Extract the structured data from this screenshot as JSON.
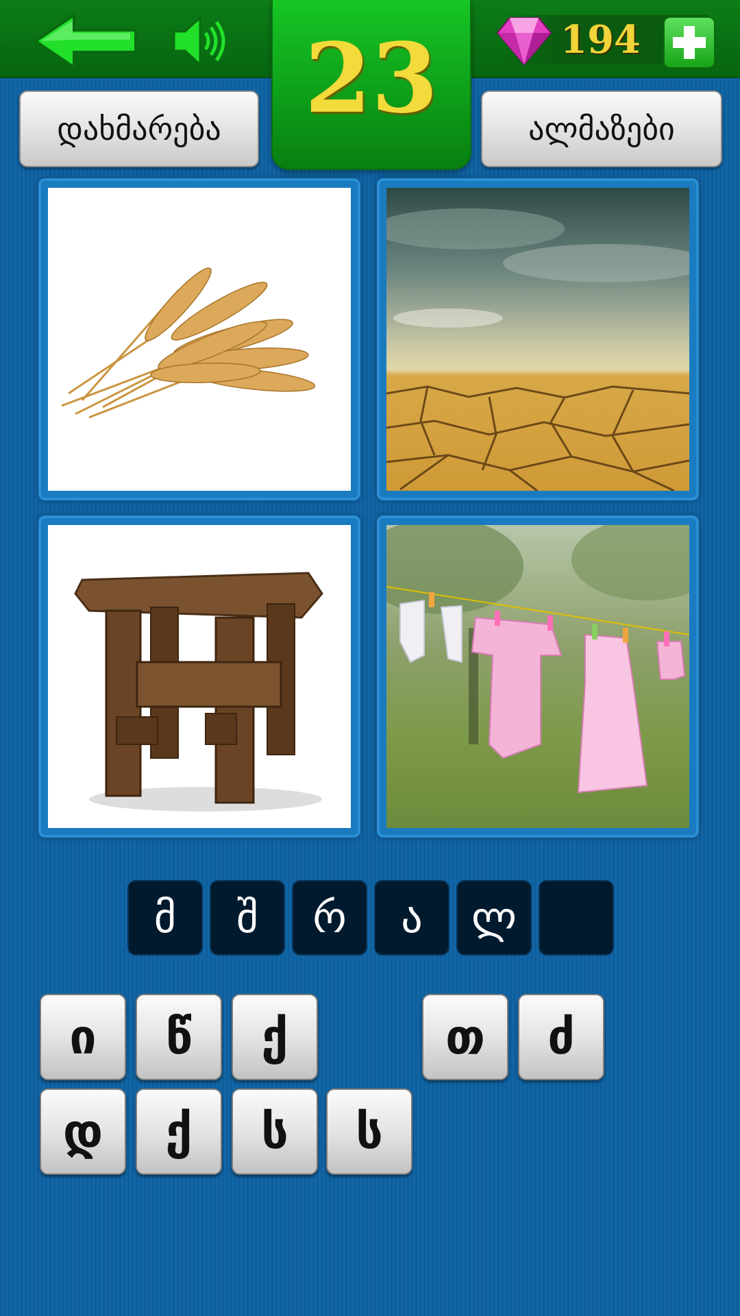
{
  "header": {
    "level": "23",
    "gems": "194",
    "help_label": "დახმარება",
    "gems_label": "ალმაზები"
  },
  "icons": {
    "back": "back-arrow-icon",
    "sound": "speaker-icon",
    "gem": "diamond-icon",
    "plus": "plus-icon"
  },
  "pictures": [
    "wheat",
    "cracked-dry-earth",
    "wooden-stool",
    "baby-clothes-on-line"
  ],
  "answer": [
    "მ",
    "შ",
    "რ",
    "ა",
    "ლ",
    ""
  ],
  "keys": {
    "row1": [
      "ი",
      "წ",
      "ქ",
      "",
      "თ",
      "ძ"
    ],
    "row2": [
      "დ",
      "ქ",
      "ს",
      "ს"
    ]
  },
  "colors": {
    "accent_green": "#0da01a",
    "level_text": "#f2db3a",
    "background": "#1266a6"
  }
}
